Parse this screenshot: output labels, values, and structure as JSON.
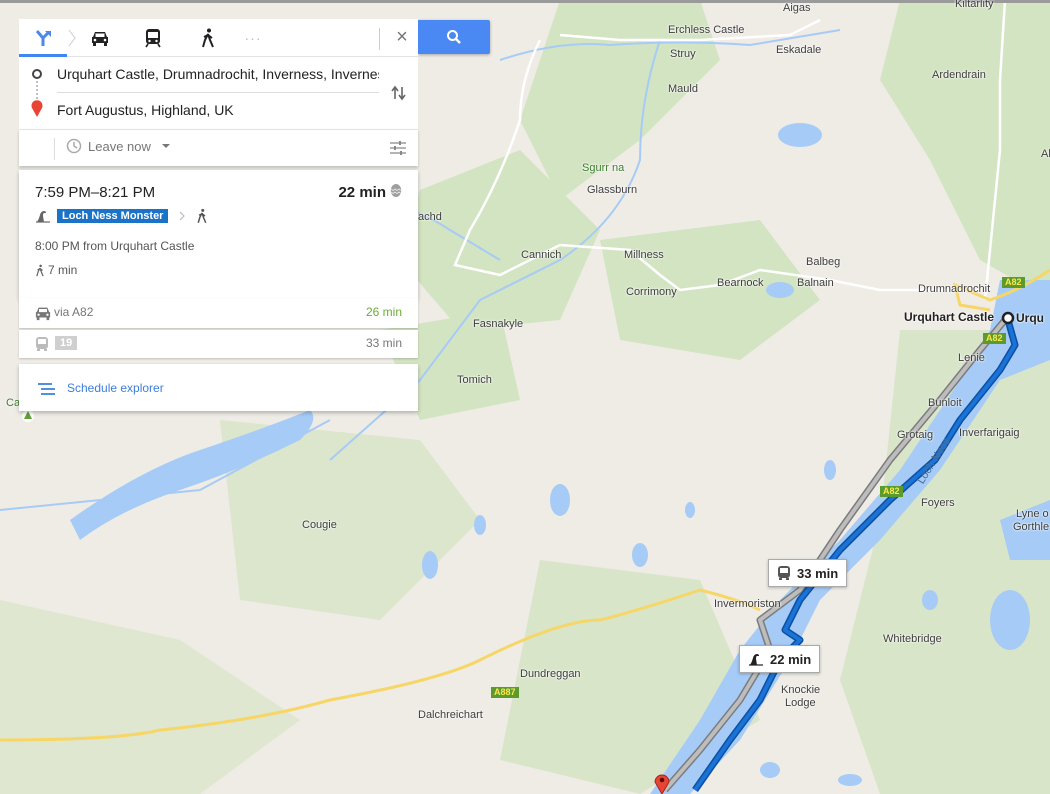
{
  "mode_bar": {
    "modes": [
      {
        "name": "best-route",
        "icon": "directions-icon",
        "active": true
      },
      {
        "name": "driving",
        "icon": "car-icon",
        "active": false
      },
      {
        "name": "transit",
        "icon": "train-icon",
        "active": false
      },
      {
        "name": "walking",
        "icon": "walk-icon",
        "active": false
      },
      {
        "name": "more",
        "icon": "more-icon",
        "label": "···",
        "active": false
      }
    ],
    "close_label": "×"
  },
  "waypoints": {
    "origin": "Urquhart Castle, Drumnadrochit, Inverness, Inverness-shire",
    "destination": "Fort Augustus, Highland, UK"
  },
  "options": {
    "leave_label": "Leave now"
  },
  "selected_trip": {
    "time_range": "7:59 PM–8:21 PM",
    "duration": "22 min",
    "line_name": "Loch Ness Monster",
    "departure": "8:00 PM from Urquhart Castle",
    "walk_time": "7 min"
  },
  "alternatives": [
    {
      "icon": "car-icon",
      "label": "via A82",
      "duration": "26 min",
      "duration_color": "#6aac34"
    },
    {
      "icon": "bus-icon",
      "label": "19",
      "duration": "33 min",
      "duration_color": "#777777"
    }
  ],
  "schedule_explorer_label": "Schedule explorer",
  "map": {
    "colors": {
      "water": "#a6cbf6",
      "land": "#efece6",
      "forest": "#d3e4c2",
      "route_primary": "#1a6fd0",
      "route_alt": "#9e9e9e",
      "road_major": "#f7d668"
    },
    "labels": [
      {
        "text": "Aigas",
        "style": ""
      },
      {
        "text": "Kiltarlity",
        "style": ""
      },
      {
        "text": "Erchless Castle",
        "style": ""
      },
      {
        "text": "Eskadale",
        "style": ""
      },
      {
        "text": "Struy",
        "style": ""
      },
      {
        "text": "Ardendrain",
        "style": ""
      },
      {
        "text": "Mauld",
        "style": ""
      },
      {
        "text": "Ab",
        "style": ""
      },
      {
        "text": "Sgurr na",
        "style": "green"
      },
      {
        "text": "Glassburn",
        "style": ""
      },
      {
        "text": "achd",
        "style": ""
      },
      {
        "text": "Cannich",
        "style": ""
      },
      {
        "text": "Millness",
        "style": ""
      },
      {
        "text": "Balbeg",
        "style": ""
      },
      {
        "text": "Bearnock",
        "style": ""
      },
      {
        "text": "Balnain",
        "style": ""
      },
      {
        "text": "Corrimony",
        "style": ""
      },
      {
        "text": "Drumnadrochit",
        "style": ""
      },
      {
        "text": "Urquhart Castle",
        "style": "bold"
      },
      {
        "text": "Urqu",
        "style": "bold"
      },
      {
        "text": "Fasnakyle",
        "style": ""
      },
      {
        "text": "Lenie",
        "style": ""
      },
      {
        "text": "Tomich",
        "style": ""
      },
      {
        "text": "Ca",
        "style": "green"
      },
      {
        "text": "Bunloit",
        "style": ""
      },
      {
        "text": "Grotaig",
        "style": ""
      },
      {
        "text": "Inverfarigaig",
        "style": ""
      },
      {
        "text": "Loch Ness",
        "style": ""
      },
      {
        "text": "Foyers",
        "style": ""
      },
      {
        "text": "Lyne o",
        "style": ""
      },
      {
        "text": "Gorthle",
        "style": ""
      },
      {
        "text": "Cougie",
        "style": ""
      },
      {
        "text": "Invermoriston",
        "style": ""
      },
      {
        "text": "Whitebridge",
        "style": ""
      },
      {
        "text": "Dundreggan",
        "style": ""
      },
      {
        "text": "Knockie",
        "style": ""
      },
      {
        "text": "Lodge",
        "style": ""
      },
      {
        "text": "Dalchreichart",
        "style": ""
      }
    ],
    "road_shields": [
      "A82",
      "A82",
      "A82",
      "A887"
    ],
    "callouts": [
      {
        "icon": "bus-icon",
        "label": "33 min"
      },
      {
        "icon": "loch-ness-monster-icon",
        "label": "22 min"
      }
    ]
  }
}
